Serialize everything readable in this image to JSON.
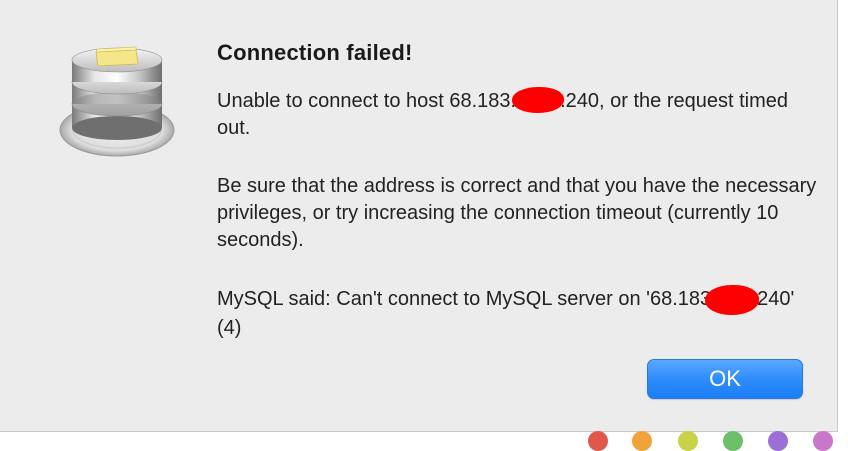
{
  "dialog": {
    "icon": "sequel-pro-database-icon",
    "title": "Connection failed!",
    "paragraph1_before": "Unable to connect to host 68.183.",
    "paragraph1_after": ".240, or the request timed out.",
    "paragraph2": "Be sure that the address is correct and that you have the necessary privileges, or try increasing the connection timeout (currently 10 seconds).",
    "paragraph3_before": "MySQL said: Can't connect to MySQL server on '68.183",
    "paragraph3_after": "240' (4)",
    "ok_label": "OK"
  },
  "colors": {
    "dialog_background": "#ececec",
    "button_accent": "#2f8dfb",
    "redaction": "#ff0000"
  }
}
